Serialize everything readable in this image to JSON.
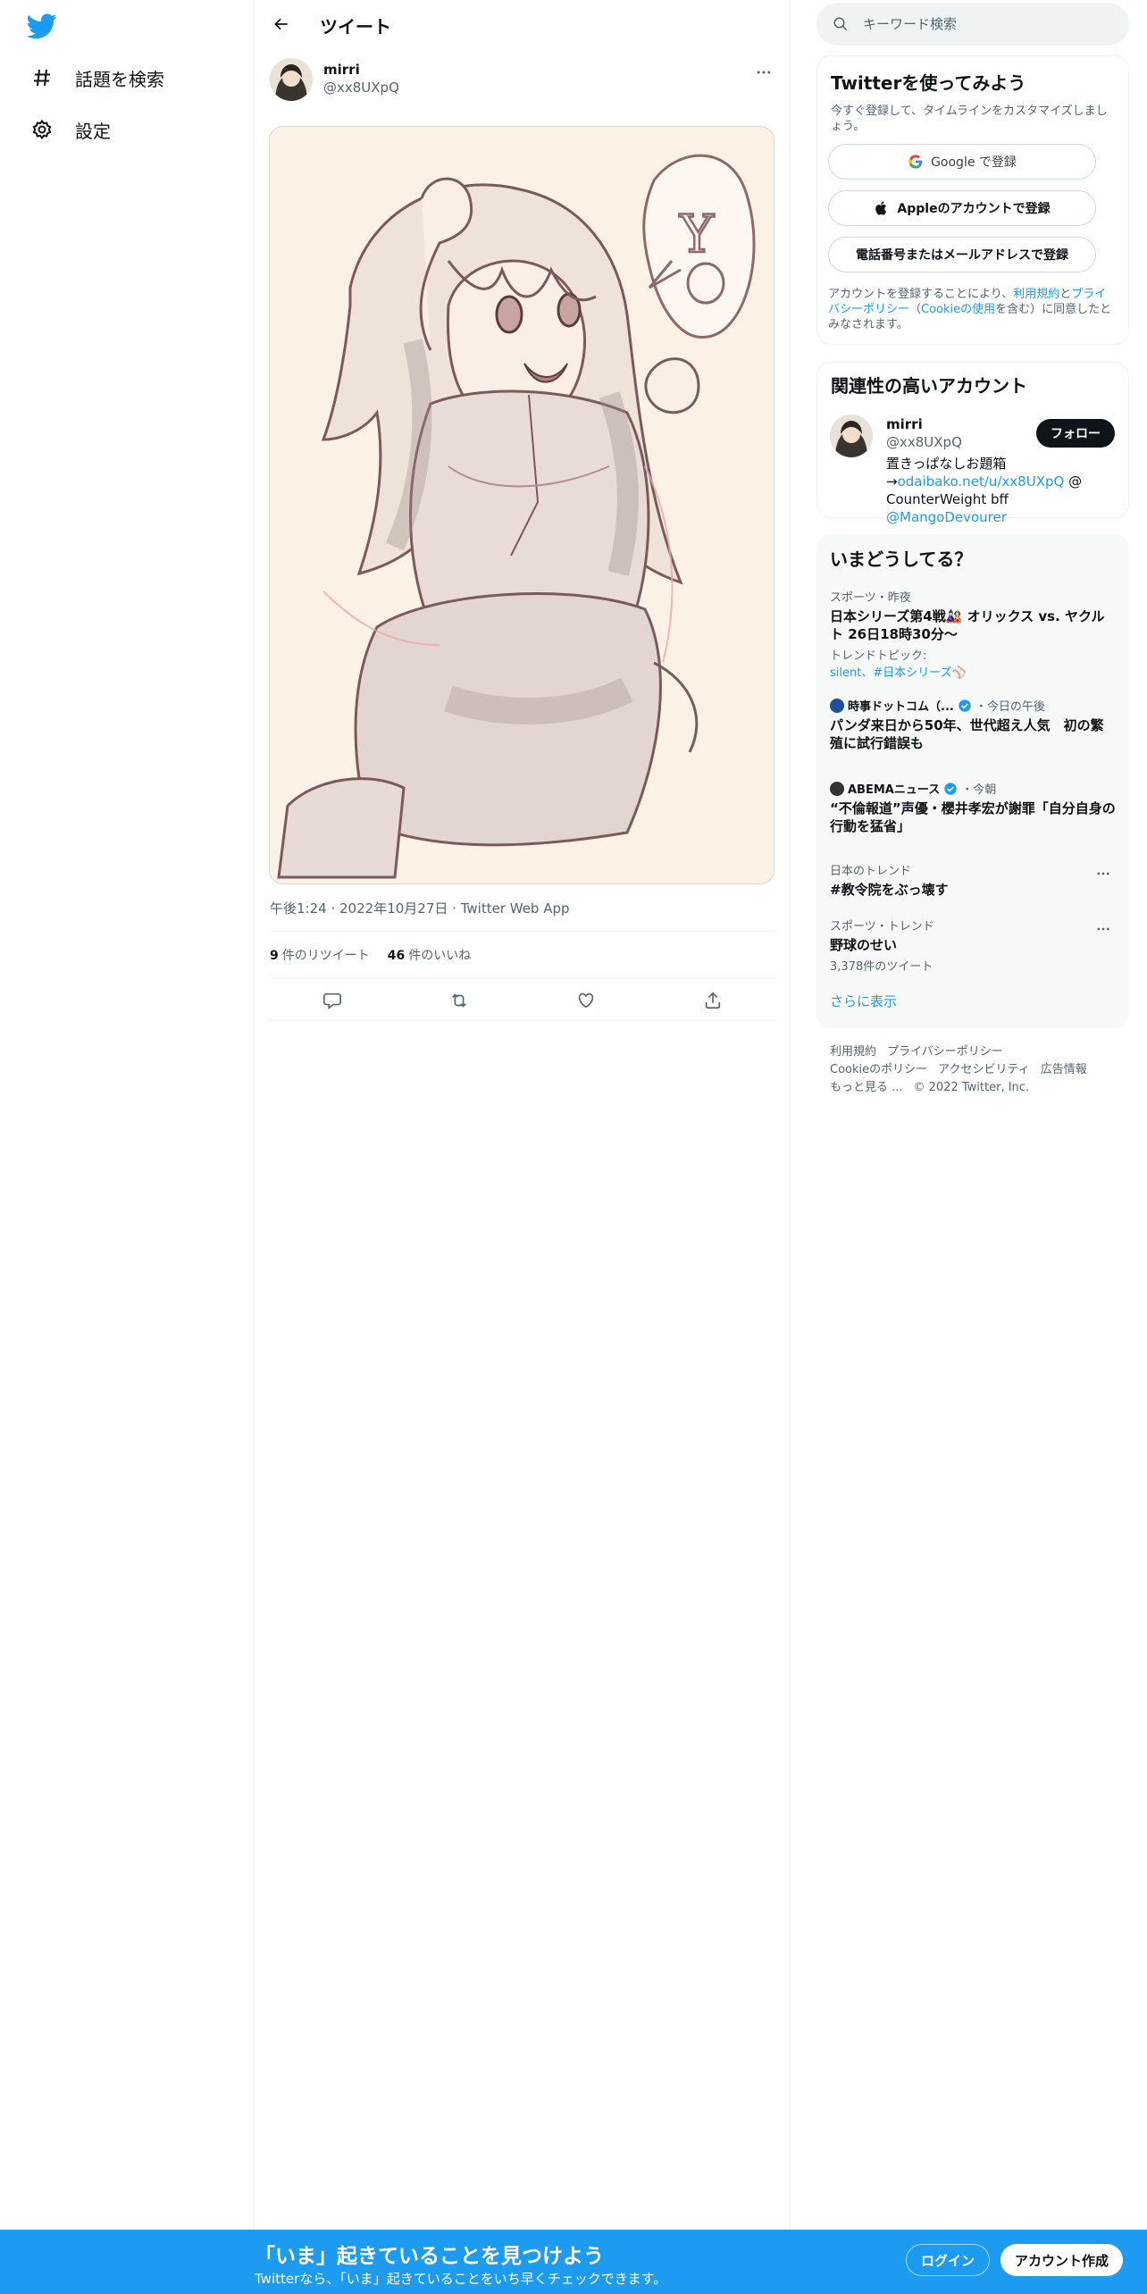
{
  "nav": {
    "logo": "twitter-bird-logo",
    "items": [
      {
        "label": "話題を検索",
        "icon": "hashtag-icon"
      },
      {
        "label": "設定",
        "icon": "gear-icon"
      }
    ]
  },
  "main": {
    "header_title": "ツイート",
    "tweet": {
      "author_name": "mirri",
      "author_handle": "@xx8UXpQ",
      "media_text": "Y O",
      "time": "午後1:24",
      "date": "2022年10月27日",
      "source": "Twitter Web App",
      "retweets_count": "9",
      "retweets_label": "件のリツイート",
      "likes_count": "46",
      "likes_label": "件のいいね"
    }
  },
  "sidebar": {
    "search_placeholder": "キーワード検索",
    "signup": {
      "title": "Twitterを使ってみよう",
      "subtitle": "今すぐ登録して、タイムラインをカスタマイズしましょう。",
      "google_label": "Google で登録",
      "apple_label": "Appleのアカウントで登録",
      "phone_label": "電話番号またはメールアドレスで登録",
      "terms_prefix": "アカウントを登録することにより、",
      "terms_link": "利用規約",
      "terms_and": "と",
      "privacy_link": "プライバシーポリシー",
      "cookie_open": "（",
      "cookie_link": "Cookieの使用",
      "terms_suffix": "を含む）に同意したとみなされます。"
    },
    "related": {
      "title": "関連性の高いアカウント",
      "name": "mirri",
      "handle": "@xx8UXpQ",
      "follow_label": "フォロー",
      "bio_1": "置きっぱなしお題箱",
      "bio_arrow": "→",
      "bio_link": "odaibako.net/u/xx8UXpQ",
      "bio_2": " @",
      "bio_3": "CounterWeight bff ",
      "bio_mention": "@MangoDevourer"
    },
    "trends": {
      "title": "いまどうしてる？",
      "items": [
        {
          "context": "スポーツ・昨夜",
          "name": "日本シリーズ第4戦🎎 オリックス vs. ヤクルト 26日18時30分〜",
          "sub_label": "トレンドトピック:",
          "sub_links": "silent、#日本シリーズ⚾"
        },
        {
          "source": "時事ドットコム（...",
          "time": "・今日の午後",
          "name": "パンダ来日から50年、世代超え人気　初の繁殖に試行錯誤も"
        },
        {
          "source": "ABEMAニュース",
          "time": "・今朝",
          "name": "“不倫報道”声優・櫻井孝宏が謝罪「自分自身の行動を猛省」"
        },
        {
          "context": "日本のトレンド",
          "name": "#教令院をぶっ壊す"
        },
        {
          "context": "スポーツ・トレンド",
          "name": "野球のせい",
          "sub": "3,378件のツイート"
        }
      ],
      "show_more": "さらに表示"
    },
    "footer": {
      "terms": "利用規約",
      "privacy": "プライバシーポリシー",
      "cookie": "Cookieのポリシー",
      "accessibility": "アクセシビリティ",
      "ads": "広告情報",
      "more": "もっと見る ...",
      "copyright": "© 2022 Twitter, Inc."
    }
  },
  "bottom_bar": {
    "title": "「いま」起きていることを見つけよう",
    "subtitle": "Twitterなら、「いま」起きていることをいち早くチェックできます。",
    "login": "ログイン",
    "signup": "アカウント作成"
  },
  "colors": {
    "brand": "#1d9bf0",
    "text": "#0f1419",
    "muted": "#536471"
  }
}
